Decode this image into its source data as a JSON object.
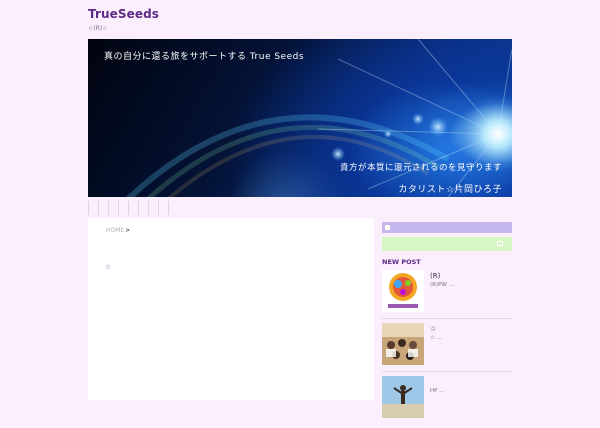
{
  "site": {
    "title": "TrueSeeds",
    "subtitle": "☆(R)☆"
  },
  "hero": {
    "line1": "真の自分に還る旅をサポートする True Seeds",
    "line2": "貴方が本質に還元されるのを見守ります",
    "line3": "カタリスト☆片岡ひろ子"
  },
  "breadcrumb": {
    "home": "HOME",
    "sep": ">"
  },
  "post": {
    "title": "☆"
  },
  "sidebar": {
    "new_post_title": "NEW POST",
    "posts": [
      {
        "title": "(R)",
        "desc": "(R)PW ..."
      },
      {
        "title": "☆",
        "desc": "☆ ..."
      },
      {
        "title": "",
        "desc": "HP ..."
      }
    ]
  },
  "colors": {
    "accent": "#5d2a86",
    "background": "#fbeefd",
    "sidebar_top": "#c6b8ee",
    "sidebar_second": "#d8f5c4"
  }
}
